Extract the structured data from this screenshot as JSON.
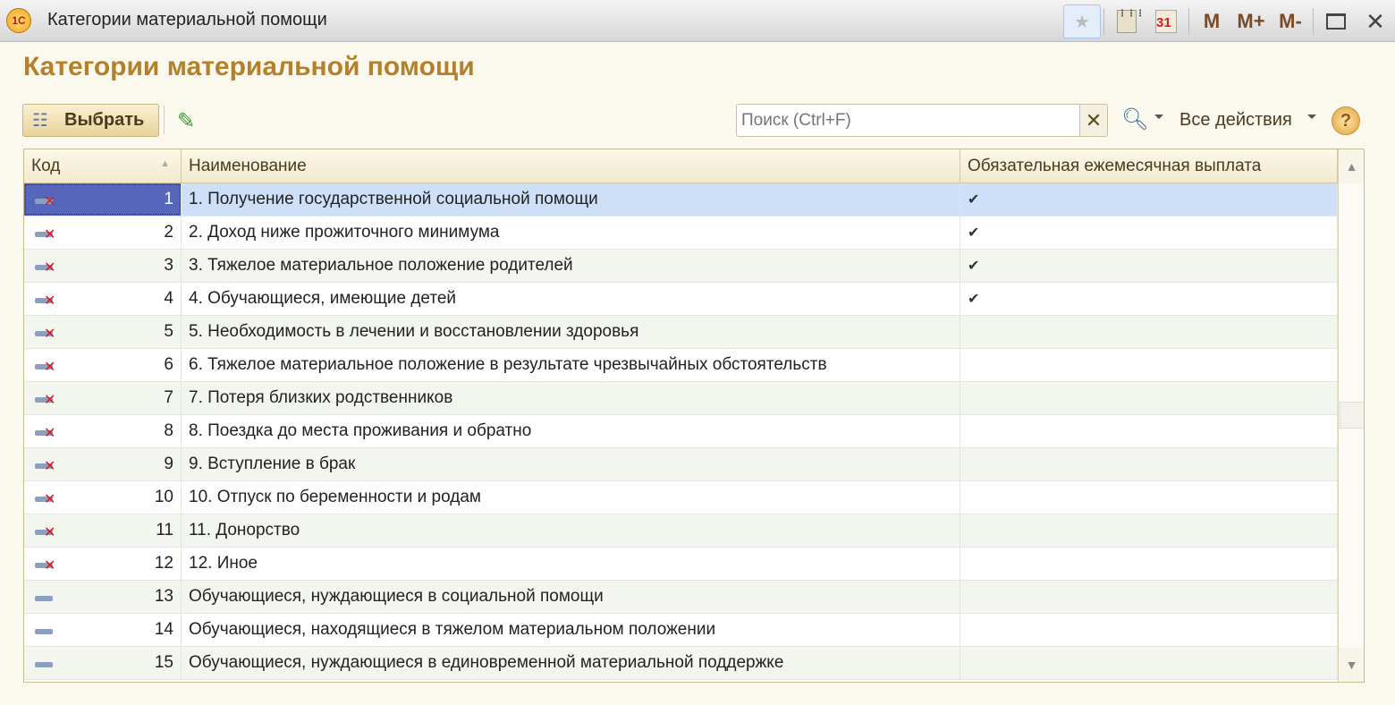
{
  "window": {
    "title": "Категории материальной помощи",
    "logo": "1С"
  },
  "titlebar_icons": [
    {
      "name": "favorite-icon"
    },
    {
      "name": "calculator-icon"
    },
    {
      "name": "calendar-icon",
      "label": "31"
    },
    {
      "name": "memory-m",
      "label": "M"
    },
    {
      "name": "memory-plus",
      "label": "M+"
    },
    {
      "name": "memory-minus",
      "label": "M-"
    },
    {
      "name": "maximize-icon"
    },
    {
      "name": "close-icon"
    }
  ],
  "page_title": "Категории материальной помощи",
  "toolbar": {
    "select_label": "Выбрать",
    "search_placeholder": "Поиск (Ctrl+F)",
    "all_actions": "Все действия",
    "help": "?"
  },
  "table": {
    "columns": [
      "Код",
      "Наименование",
      "Обязательная ежемесячная выплата"
    ],
    "rows": [
      {
        "code": "1",
        "name": "1. Получение государственной социальной помощи",
        "required": true,
        "deleted": true
      },
      {
        "code": "2",
        "name": "2. Доход ниже прожиточного минимума",
        "required": true,
        "deleted": true
      },
      {
        "code": "3",
        "name": "3. Тяжелое материальное положение родителей",
        "required": true,
        "deleted": true
      },
      {
        "code": "4",
        "name": "4. Обучающиеся, имеющие детей",
        "required": true,
        "deleted": true
      },
      {
        "code": "5",
        "name": "5. Необходимость в лечении и восстановлении здоровья",
        "required": false,
        "deleted": true
      },
      {
        "code": "6",
        "name": "6. Тяжелое материальное положение в результате чрезвычайных обстоятельств",
        "required": false,
        "deleted": true
      },
      {
        "code": "7",
        "name": "7. Потеря близких родственников",
        "required": false,
        "deleted": true
      },
      {
        "code": "8",
        "name": "8. Поездка до места проживания и обратно",
        "required": false,
        "deleted": true
      },
      {
        "code": "9",
        "name": "9. Вступление в брак",
        "required": false,
        "deleted": true
      },
      {
        "code": "10",
        "name": "10. Отпуск по беременности и родам",
        "required": false,
        "deleted": true
      },
      {
        "code": "11",
        "name": "11. Донорство",
        "required": false,
        "deleted": true
      },
      {
        "code": "12",
        "name": "12. Иное",
        "required": false,
        "deleted": true
      },
      {
        "code": "13",
        "name": "Обучающиеся, нуждающиеся в социальной помощи",
        "required": false,
        "deleted": false
      },
      {
        "code": "14",
        "name": "Обучающиеся, находящиеся в тяжелом материальном положении",
        "required": false,
        "deleted": false
      },
      {
        "code": "15",
        "name": "Обучающиеся, нуждающиеся в единовременной материальной поддержке",
        "required": false,
        "deleted": false
      }
    ],
    "selected_index": 0
  }
}
